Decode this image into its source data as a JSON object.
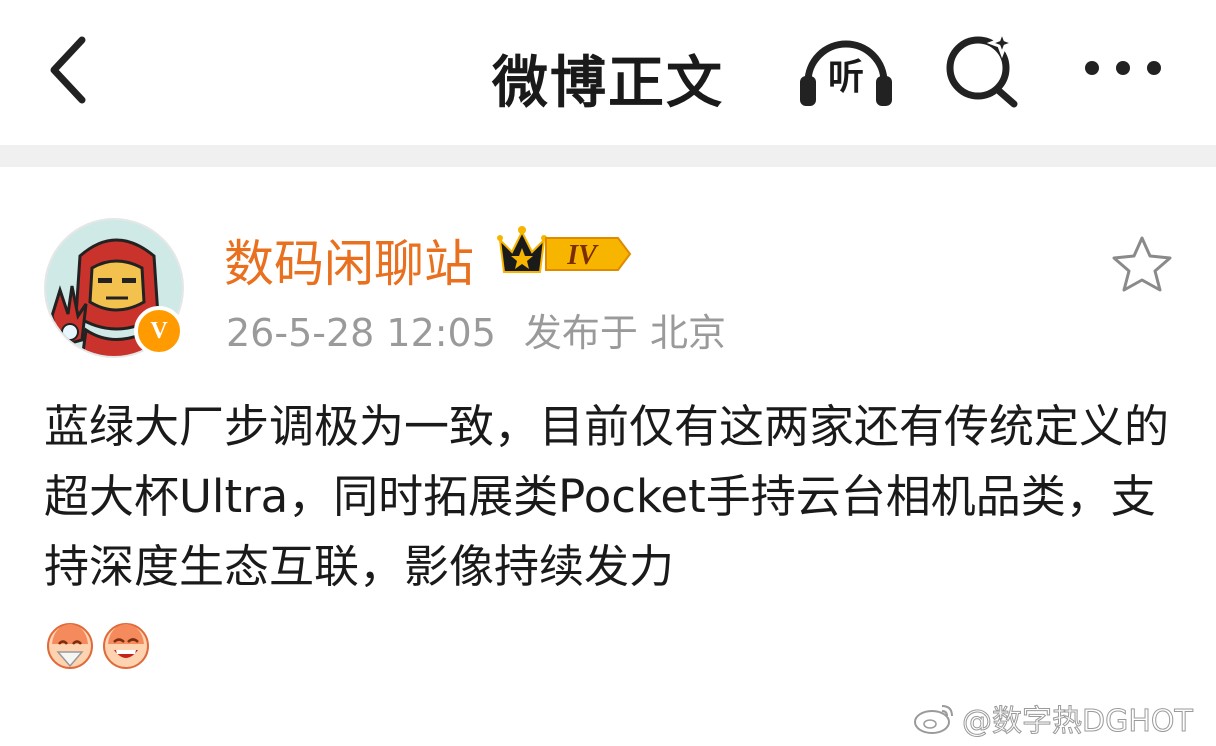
{
  "header": {
    "title": "微博正文",
    "listen_label": "听"
  },
  "post": {
    "author": {
      "name": "数码闲聊站",
      "level_badge": "IV",
      "verified_badge": "V"
    },
    "timestamp": "26-5-28 12:05",
    "location": "发布于 北京",
    "text": "蓝绿大厂步调极为一致，目前仅有这两家还有传统定义的超大杯Ultra，同时拓展类Pocket手持云台相机品类，支持深度生态互联，影像持续发力",
    "emojis": [
      "laugh-cover-face-emoji",
      "grin-emoji"
    ]
  },
  "watermark": {
    "text": "@数字热DGHOT"
  },
  "colors": {
    "username": "#e8701e",
    "meta": "#9a9a9a",
    "divider": "#f0f0f0",
    "verified": "#ff9a00",
    "level_badge": "#f7b500"
  }
}
